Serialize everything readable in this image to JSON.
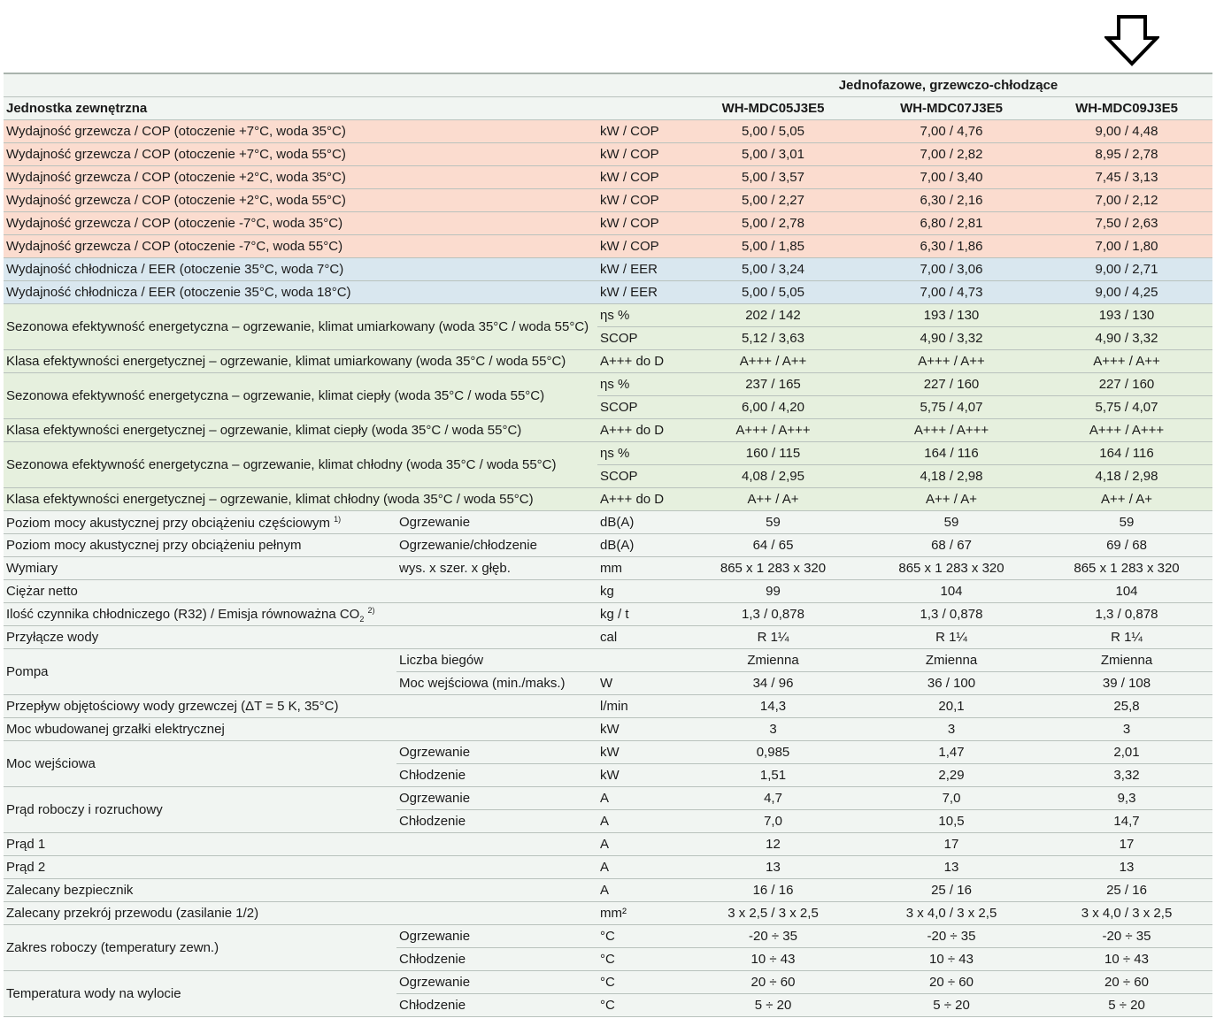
{
  "header": {
    "group_title": "Jednofazowe, grzewczo-chłodzące",
    "row_label": "Jednostka zewnętrzna",
    "models": [
      "WH-MDC05J3E5",
      "WH-MDC07J3E5",
      "WH-MDC09J3E5"
    ]
  },
  "heating_rows": [
    {
      "label": "Wydajność grzewcza / COP (otoczenie +7°C, woda 35°C)",
      "unit": "kW / COP",
      "values": [
        "5,00 / 5,05",
        "7,00 / 4,76",
        "9,00 / 4,48"
      ]
    },
    {
      "label": "Wydajność grzewcza / COP (otoczenie +7°C, woda 55°C)",
      "unit": "kW / COP",
      "values": [
        "5,00 / 3,01",
        "7,00 / 2,82",
        "8,95 / 2,78"
      ]
    },
    {
      "label": "Wydajność grzewcza / COP (otoczenie +2°C, woda 35°C)",
      "unit": "kW / COP",
      "values": [
        "5,00 / 3,57",
        "7,00 / 3,40",
        "7,45 / 3,13"
      ]
    },
    {
      "label": "Wydajność grzewcza / COP (otoczenie +2°C, woda 55°C)",
      "unit": "kW / COP",
      "values": [
        "5,00 / 2,27",
        "6,30 / 2,16",
        "7,00 / 2,12"
      ]
    },
    {
      "label": "Wydajność grzewcza / COP (otoczenie -7°C, woda 35°C)",
      "unit": "kW / COP",
      "values": [
        "5,00 / 2,78",
        "6,80 / 2,81",
        "7,50 / 2,63"
      ]
    },
    {
      "label": "Wydajność grzewcza / COP (otoczenie -7°C, woda 55°C)",
      "unit": "kW / COP",
      "values": [
        "5,00 / 1,85",
        "6,30 / 1,86",
        "7,00 / 1,80"
      ]
    }
  ],
  "cooling_rows": [
    {
      "label": "Wydajność chłodnicza / EER (otoczenie 35°C, woda 7°C)",
      "unit": "kW / EER",
      "values": [
        "5,00 / 3,24",
        "7,00 / 3,06",
        "9,00 / 2,71"
      ]
    },
    {
      "label": "Wydajność chłodnicza / EER (otoczenie 35°C, woda 18°C)",
      "unit": "kW / EER",
      "values": [
        "5,00 / 5,05",
        "7,00 / 4,73",
        "9,00 / 4,25"
      ]
    }
  ],
  "seasonal": [
    {
      "label": "Sezonowa efektywność energetyczna – ogrzewanie, klimat umiarkowany (woda 35°C / woda 55°C)",
      "eta_unit": "ηs %",
      "eta": [
        "202 / 142",
        "193 / 130",
        "193 / 130"
      ],
      "scop_unit": "SCOP",
      "scop": [
        "5,12 / 3,63",
        "4,90 / 3,32",
        "4,90 / 3,32"
      ],
      "class_label": "Klasa efektywności energetycznej – ogrzewanie, klimat umiarkowany (woda 35°C / woda 55°C)",
      "class_unit": "A+++ do D",
      "class": [
        "A+++ / A++",
        "A+++ / A++",
        "A+++ / A++"
      ]
    },
    {
      "label": "Sezonowa efektywność energetyczna – ogrzewanie, klimat ciepły (woda 35°C / woda 55°C)",
      "eta_unit": "ηs %",
      "eta": [
        "237 / 165",
        "227 / 160",
        "227 / 160"
      ],
      "scop_unit": "SCOP",
      "scop": [
        "6,00 / 4,20",
        "5,75 / 4,07",
        "5,75 / 4,07"
      ],
      "class_label": "Klasa efektywności energetycznej – ogrzewanie, klimat ciepły (woda 35°C / woda 55°C)",
      "class_unit": "A+++ do D",
      "class": [
        "A+++ / A+++",
        "A+++ / A+++",
        "A+++ / A+++"
      ]
    },
    {
      "label": "Sezonowa efektywność energetyczna – ogrzewanie, klimat chłodny (woda 35°C / woda 55°C)",
      "eta_unit": "ηs %",
      "eta": [
        "160 / 115",
        "164 / 116",
        "164 / 116"
      ],
      "scop_unit": "SCOP",
      "scop": [
        "4,08 / 2,95",
        "4,18 / 2,98",
        "4,18 / 2,98"
      ],
      "class_label": "Klasa efektywności energetycznej – ogrzewanie, klimat chłodny (woda 35°C / woda 55°C)",
      "class_unit": "A+++ do D",
      "class": [
        "A++ / A+",
        "A++ / A+",
        "A++ / A+"
      ]
    }
  ],
  "specs": {
    "noise_partial": {
      "label": "Poziom mocy akustycznej przy obciążeniu częściowym",
      "note": "1)",
      "sub": "Ogrzewanie",
      "unit": "dB(A)",
      "values": [
        "59",
        "59",
        "59"
      ]
    },
    "noise_full": {
      "label": "Poziom mocy akustycznej przy obciążeniu pełnym",
      "sub": "Ogrzewanie/chłodzenie",
      "unit": "dB(A)",
      "values": [
        "64 / 65",
        "68 / 67",
        "69 / 68"
      ]
    },
    "dimensions": {
      "label": "Wymiary",
      "sub": "wys. x szer. x głęb.",
      "unit": "mm",
      "values": [
        "865 x 1 283 x 320",
        "865 x 1 283 x 320",
        "865 x 1 283 x 320"
      ]
    },
    "weight": {
      "label": "Ciężar netto",
      "unit": "kg",
      "values": [
        "99",
        "104",
        "104"
      ]
    },
    "refrigerant": {
      "label": "Ilość czynnika chłodniczego (R32) / Emisja równoważna CO",
      "sub_script": "2",
      "note": "2)",
      "unit": "kg / t",
      "values": [
        "1,3 / 0,878",
        "1,3 / 0,878",
        "1,3 / 0,878"
      ]
    },
    "water_conn": {
      "label": "Przyłącze wody",
      "unit": "cal",
      "values": [
        "R 1¼",
        "R 1¼",
        "R 1¼"
      ]
    },
    "pump": {
      "label": "Pompa",
      "speeds": {
        "sub": "Liczba biegów",
        "unit": "",
        "values": [
          "Zmienna",
          "Zmienna",
          "Zmienna"
        ]
      },
      "power": {
        "sub": "Moc wejściowa (min./maks.)",
        "unit": "W",
        "values": [
          "34 / 96",
          "36 / 100",
          "39 / 108"
        ]
      }
    },
    "flow": {
      "label": "Przepływ objętościowy wody grzewczej (ΔT = 5 K, 35°C)",
      "unit": "l/min",
      "values": [
        "14,3",
        "20,1",
        "25,8"
      ]
    },
    "heater": {
      "label": "Moc wbudowanej grzałki elektrycznej",
      "unit": "kW",
      "values": [
        "3",
        "3",
        "3"
      ]
    },
    "input_power": {
      "label": "Moc wejściowa",
      "heat": {
        "sub": "Ogrzewanie",
        "unit": "kW",
        "values": [
          "0,985",
          "1,47",
          "2,01"
        ]
      },
      "cool": {
        "sub": "Chłodzenie",
        "unit": "kW",
        "values": [
          "1,51",
          "2,29",
          "3,32"
        ]
      }
    },
    "current": {
      "label": "Prąd roboczy i rozruchowy",
      "heat": {
        "sub": "Ogrzewanie",
        "unit": "A",
        "values": [
          "4,7",
          "7,0",
          "9,3"
        ]
      },
      "cool": {
        "sub": "Chłodzenie",
        "unit": "A",
        "values": [
          "7,0",
          "10,5",
          "14,7"
        ]
      }
    },
    "current1": {
      "label": "Prąd 1",
      "unit": "A",
      "values": [
        "12",
        "17",
        "17"
      ]
    },
    "current2": {
      "label": "Prąd 2",
      "unit": "A",
      "values": [
        "13",
        "13",
        "13"
      ]
    },
    "fuse": {
      "label": "Zalecany bezpiecznik",
      "unit": "A",
      "values": [
        "16 / 16",
        "25 / 16",
        "25 / 16"
      ]
    },
    "cable": {
      "label": "Zalecany przekrój przewodu (zasilanie 1/2)",
      "unit": "mm²",
      "values": [
        "3 x 2,5 / 3 x 2,5",
        "3 x 4,0 / 3 x 2,5",
        "3 x 4,0 / 3 x 2,5"
      ]
    },
    "op_range": {
      "label": "Zakres roboczy (temperatury zewn.)",
      "heat": {
        "sub": "Ogrzewanie",
        "unit": "°C",
        "values": [
          "-20 ÷ 35",
          "-20 ÷ 35",
          "-20 ÷ 35"
        ]
      },
      "cool": {
        "sub": "Chłodzenie",
        "unit": "°C",
        "values": [
          "10 ÷ 43",
          "10 ÷ 43",
          "10 ÷ 43"
        ]
      }
    },
    "water_out": {
      "label": "Temperatura wody na wylocie",
      "heat": {
        "sub": "Ogrzewanie",
        "unit": "°C",
        "values": [
          "20 ÷ 60",
          "20 ÷ 60",
          "20 ÷ 60"
        ]
      },
      "cool": {
        "sub": "Chłodzenie",
        "unit": "°C",
        "values": [
          "5 ÷ 20",
          "5 ÷ 20",
          "5 ÷ 20"
        ]
      }
    }
  }
}
